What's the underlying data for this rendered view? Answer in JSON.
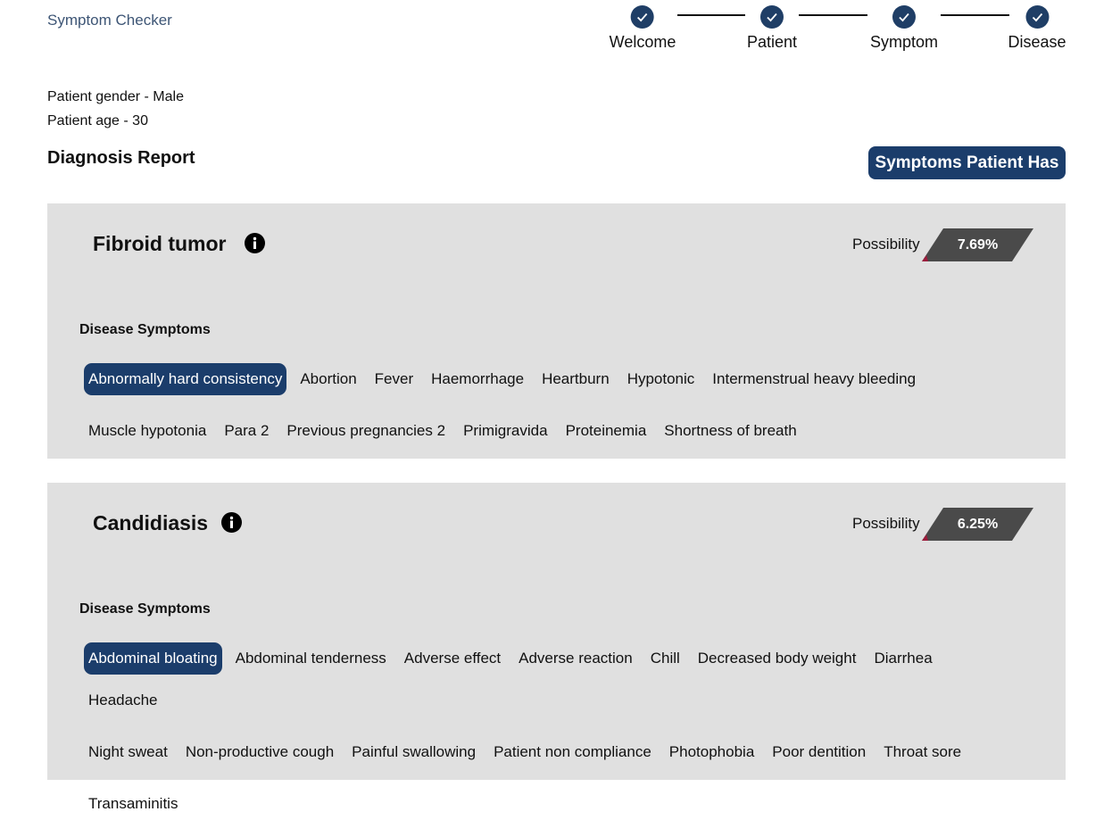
{
  "app": {
    "brand": "Symptom Checker"
  },
  "steps": [
    {
      "label": "Welcome"
    },
    {
      "label": "Patient"
    },
    {
      "label": "Symptom"
    },
    {
      "label": "Disease"
    }
  ],
  "patient": {
    "gender": "Patient gender - Male",
    "age": "Patient age - 30"
  },
  "report": {
    "title": "Diagnosis Report",
    "symptoms_button": "Symptoms Patient Has"
  },
  "colors": {
    "primary": "#1b3d6b",
    "card_bg": "#e0e0e0",
    "badge": "#4a4a4a"
  },
  "diseases": [
    {
      "name": "Fibroid tumor",
      "possibility_label": "Possibility",
      "possibility": "7.69%",
      "symptoms_label": "Disease Symptoms",
      "symptoms": [
        "Abnormally hard consistency",
        "Abortion",
        "Fever",
        "Haemorrhage",
        "Heartburn",
        "Hypotonic",
        "Intermenstrual heavy bleeding",
        "Muscle hypotonia",
        "Para 2",
        "Previous pregnancies 2",
        "Primigravida",
        "Proteinemia",
        "Shortness of breath"
      ],
      "highlighted": "Abnormally hard consistency"
    },
    {
      "name": "Candidiasis",
      "possibility_label": "Possibility",
      "possibility": "6.25%",
      "symptoms_label": "Disease Symptoms",
      "symptoms": [
        "Abdominal bloating",
        "Abdominal tenderness",
        "Adverse effect",
        "Adverse reaction",
        "Chill",
        "Decreased body weight",
        "Diarrhea",
        "Headache",
        "Night sweat",
        "Non-productive cough",
        "Painful swallowing",
        "Patient non compliance",
        "Photophobia",
        "Poor dentition",
        "Throat sore",
        "Transaminitis"
      ],
      "highlighted": "Abdominal bloating"
    }
  ]
}
